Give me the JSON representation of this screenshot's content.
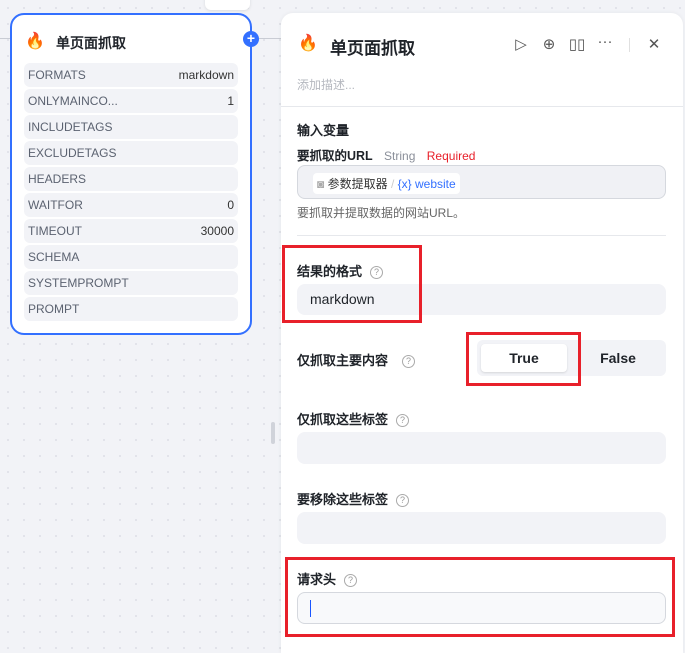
{
  "node": {
    "title": "单页面抓取",
    "icon": "fire-icon",
    "rows": [
      {
        "key": "FORMATS",
        "value": "markdown"
      },
      {
        "key": "ONLYMAINCO...",
        "value": "1"
      },
      {
        "key": "INCLUDETAGS",
        "value": ""
      },
      {
        "key": "EXCLUDETAGS",
        "value": ""
      },
      {
        "key": "HEADERS",
        "value": ""
      },
      {
        "key": "WAITFOR",
        "value": "0"
      },
      {
        "key": "TIMEOUT",
        "value": "30000"
      },
      {
        "key": "SCHEMA",
        "value": ""
      },
      {
        "key": "SYSTEMPROMPT",
        "value": ""
      },
      {
        "key": "PROMPT",
        "value": ""
      }
    ]
  },
  "panel": {
    "title": "单页面抓取",
    "description_placeholder": "添加描述...",
    "inputs_heading": "输入变量",
    "url": {
      "label": "要抓取的URL",
      "type": "String",
      "required": "Required",
      "source": "参数提取器",
      "sep": "/",
      "var_icon": "{x}",
      "var": "website",
      "help": "要抓取并提取数据的网站URL。"
    },
    "format": {
      "label": "结果的格式",
      "value": "markdown"
    },
    "only_main": {
      "label": "仅抓取主要内容",
      "options": [
        "True",
        "False"
      ],
      "selected": "True"
    },
    "include_tags": {
      "label": "仅抓取这些标签",
      "value": ""
    },
    "exclude_tags": {
      "label": "要移除这些标签",
      "value": ""
    },
    "headers": {
      "label": "请求头",
      "value": ""
    }
  },
  "colors": {
    "accent": "#3370ff",
    "required": "#e8202a",
    "highlight": "#e8202a"
  }
}
